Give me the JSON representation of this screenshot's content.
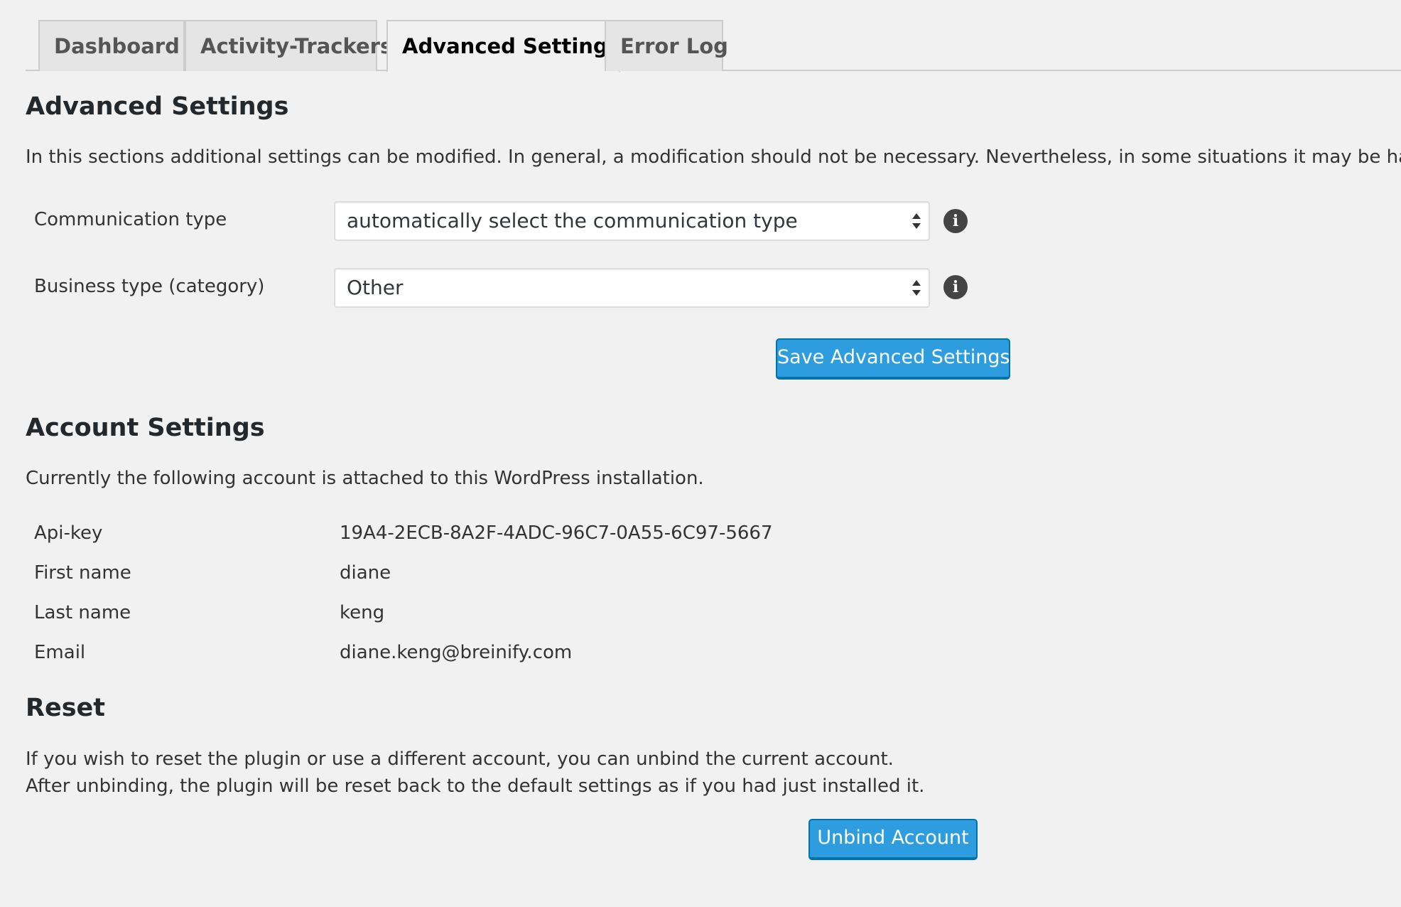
{
  "tabs": [
    {
      "label": "Dashboard",
      "active": false
    },
    {
      "label": "Activity-Trackers",
      "active": false
    },
    {
      "label": "Advanced Settings",
      "active": true
    },
    {
      "label": "Error Log",
      "active": false
    }
  ],
  "advanced": {
    "title": "Advanced Settings",
    "description": "In this sections additional settings can be modified. In general, a modification should not be necessary. Nevertheless, in some situations it may be handy.",
    "fields": [
      {
        "label": "Communication type",
        "value": "automatically select the communication type"
      },
      {
        "label": "Business type (category)",
        "value": "Other"
      }
    ],
    "info_icon": "info-icon",
    "save_label": "Save Advanced Settings"
  },
  "account": {
    "title": "Account Settings",
    "description": "Currently the following account is attached to this WordPress installation.",
    "rows": [
      {
        "label": "Api-key",
        "value": "19A4-2ECB-8A2F-4ADC-96C7-0A55-6C97-5667"
      },
      {
        "label": "First name",
        "value": "diane"
      },
      {
        "label": "Last name",
        "value": "keng"
      },
      {
        "label": "Email",
        "value": "diane.keng@breinify.com"
      }
    ]
  },
  "reset": {
    "title": "Reset",
    "line1": "If you wish to reset the plugin or use a different account, you can unbind the current account.",
    "line2": "After unbinding, the plugin will be reset back to the default settings as if you had just installed it.",
    "button_label": "Unbind Account"
  },
  "colors": {
    "background": "#f1f1f1",
    "button": "#2e9de0",
    "button_border": "#0073aa",
    "tab_inactive": "#e5e5e5"
  }
}
